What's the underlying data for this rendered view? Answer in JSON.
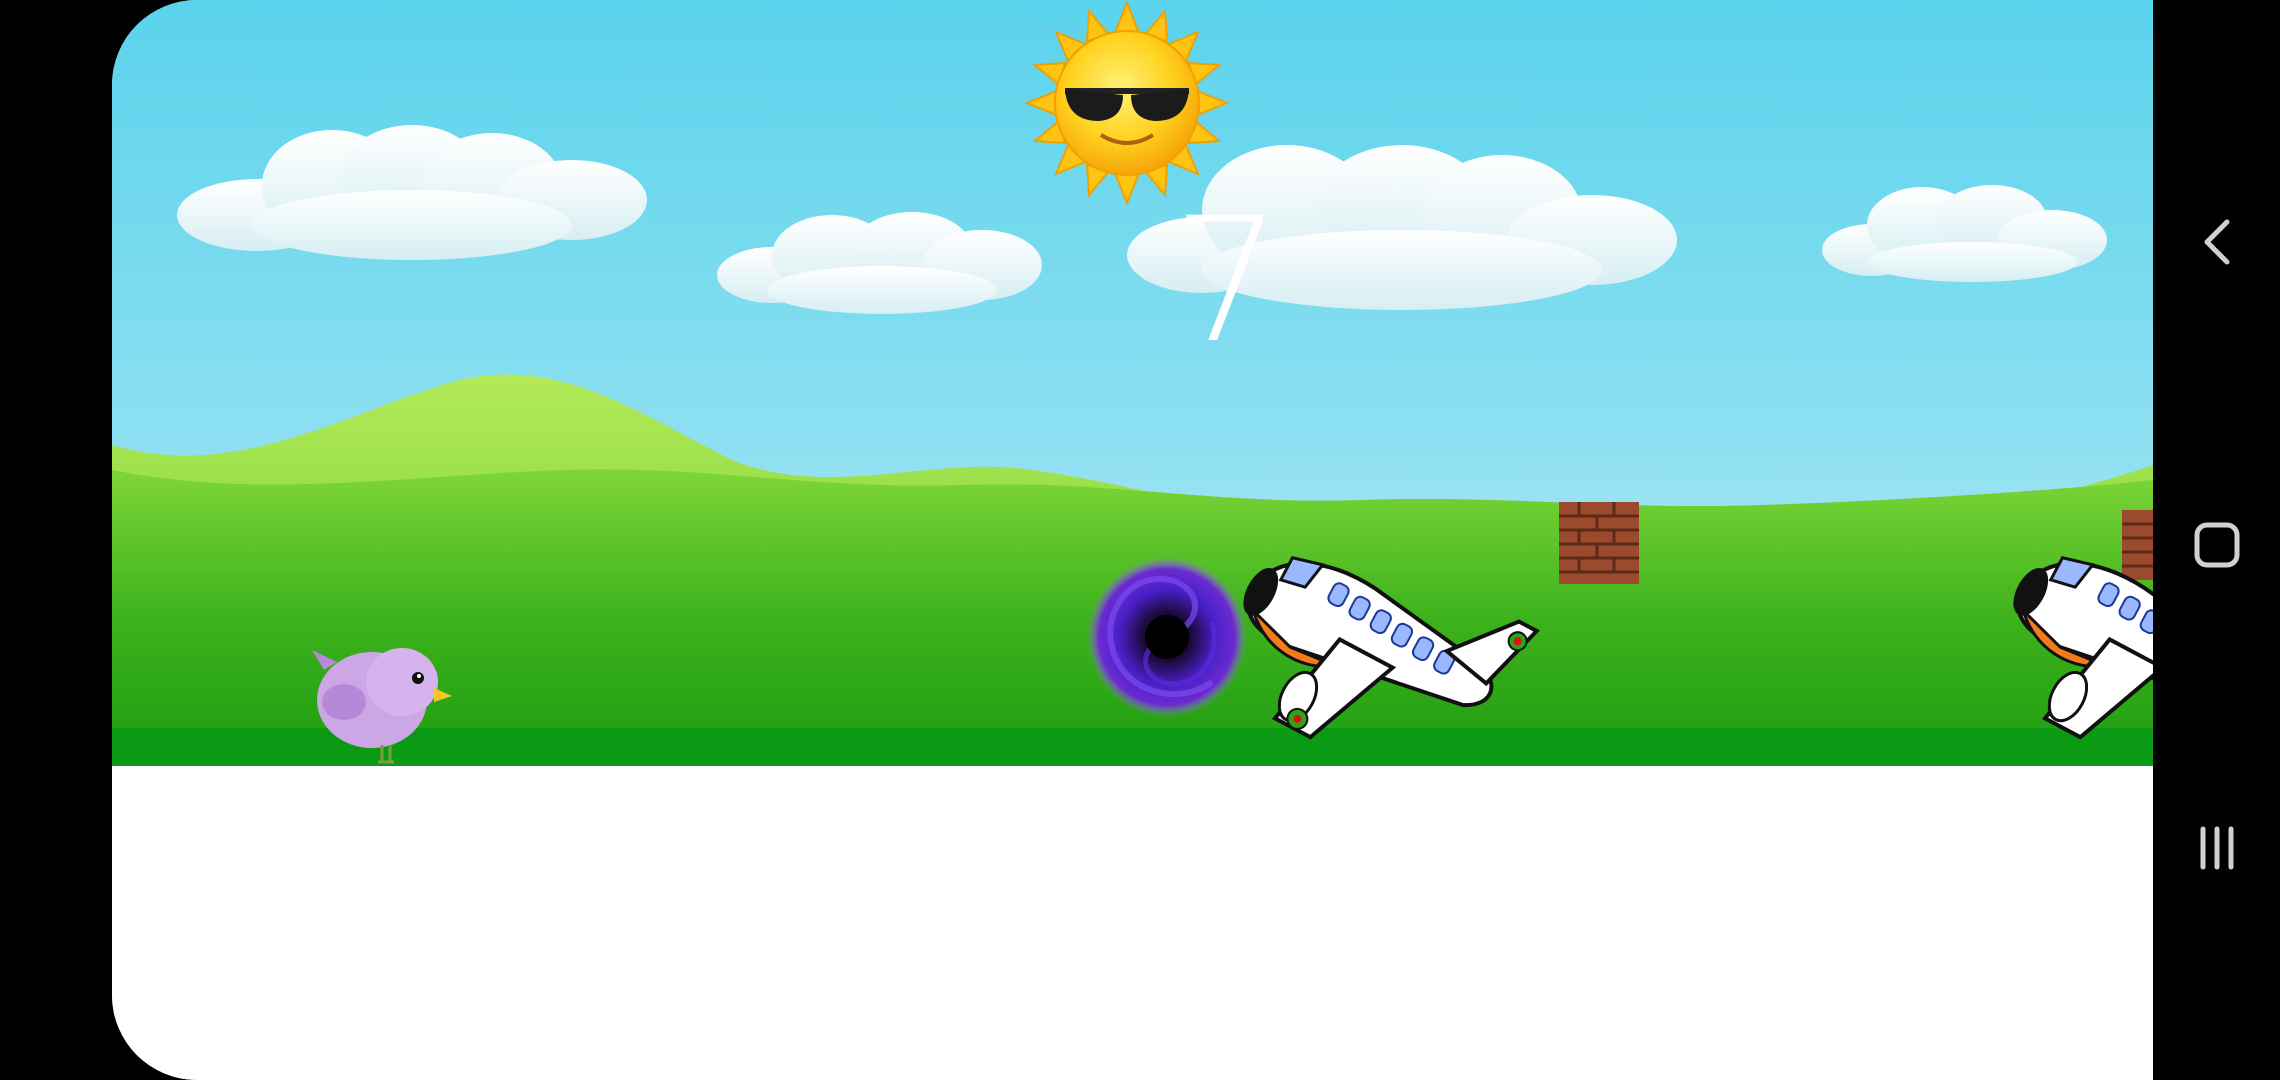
{
  "game": {
    "score": "7"
  },
  "colors": {
    "sky_top": "#5ad3ec",
    "sky_bottom": "#d4f1f7",
    "hill_back": "#a6e24a",
    "grass": "#2aa614",
    "ground_strip": "#0b9a14",
    "bird": "#cda6e6",
    "vortex": "#3a1fb8",
    "sun": "#ffd21e",
    "brick": "#9b4a2e"
  },
  "navigation_bar": {
    "back_icon": "chevron-left-icon",
    "home_icon": "rounded-square-icon",
    "recents_icon": "three-bars-icon"
  }
}
